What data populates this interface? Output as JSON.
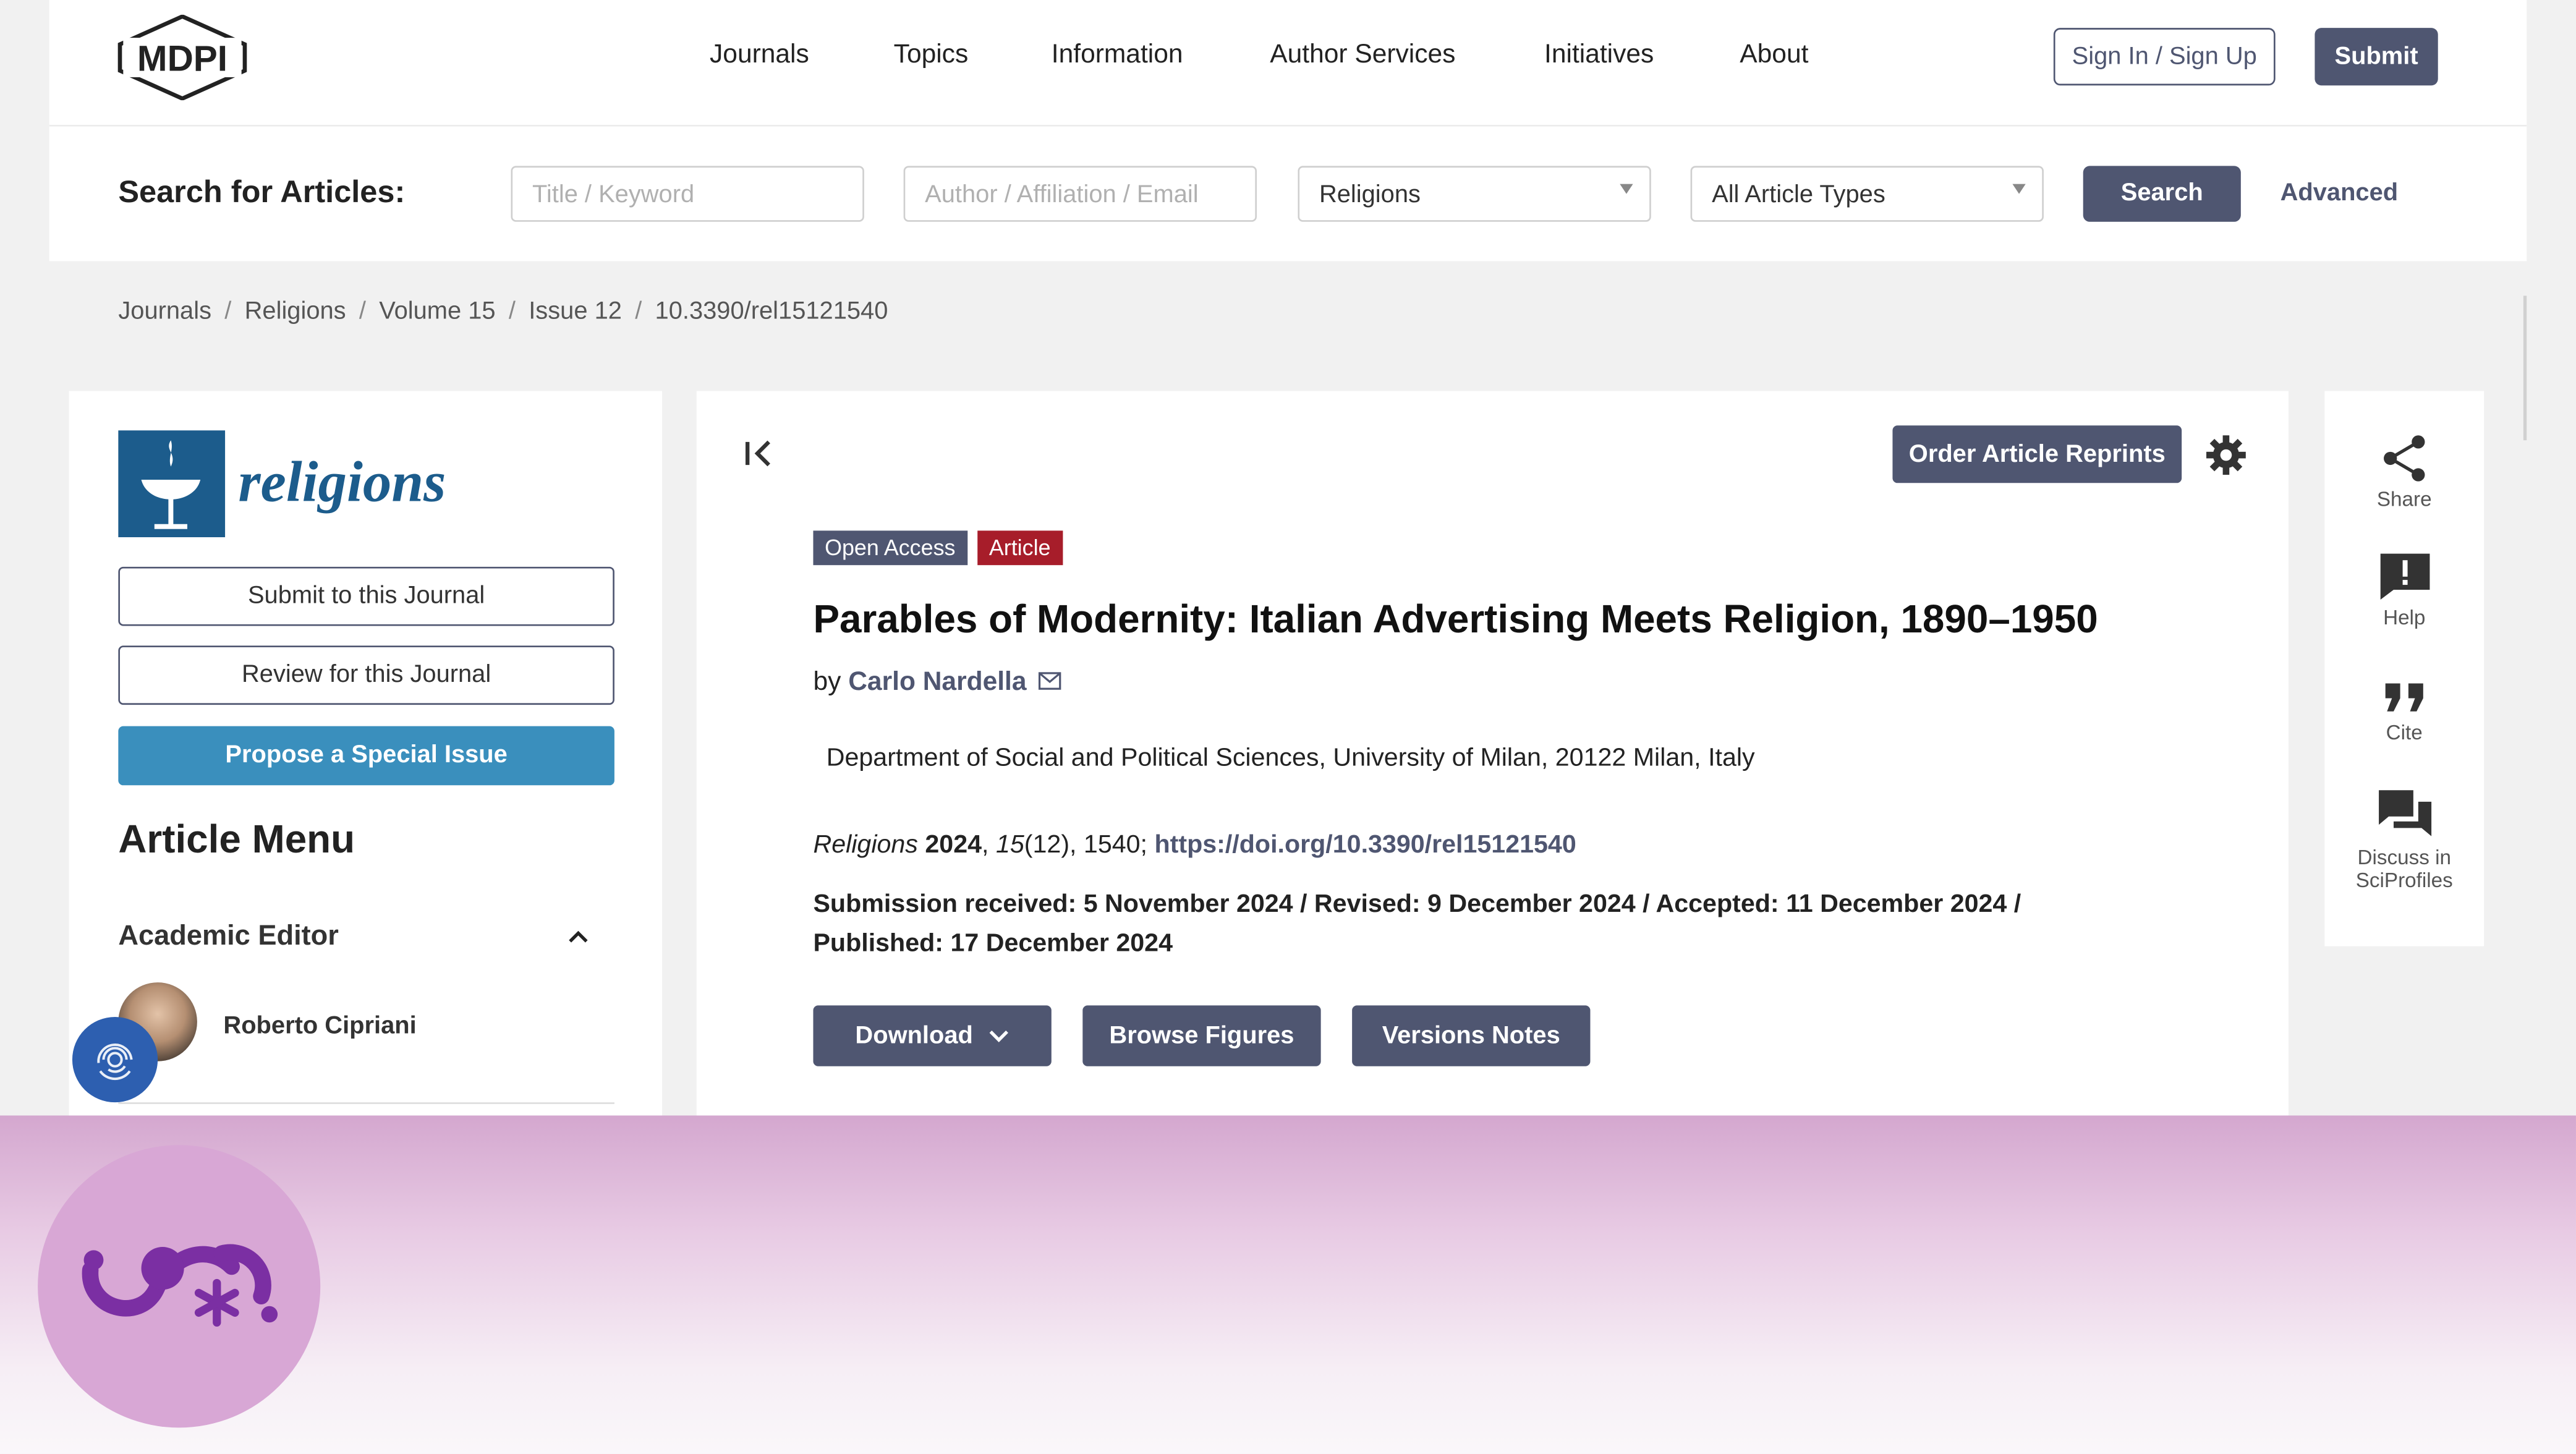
{
  "header": {
    "logo_text": "MDPI",
    "nav": [
      "Journals",
      "Topics",
      "Information",
      "Author Services",
      "Initiatives",
      "About"
    ],
    "sign_in": "Sign In / Sign Up",
    "submit": "Submit"
  },
  "search": {
    "label": "Search for Articles:",
    "keyword_placeholder": "Title / Keyword",
    "author_placeholder": "Author / Affiliation / Email",
    "journal_value": "Religions",
    "type_value": "All Article Types",
    "search_button": "Search",
    "advanced": "Advanced"
  },
  "breadcrumb": [
    "Journals",
    "Religions",
    "Volume 15",
    "Issue 12",
    "10.3390/rel15121540"
  ],
  "sidebar": {
    "journal_name": "religions",
    "submit": "Submit to this Journal",
    "review": "Review for this Journal",
    "propose": "Propose a Special Issue",
    "menu_title": "Article Menu",
    "editor_heading": "Academic Editor",
    "editor_name": "Roberto Cipriani"
  },
  "article": {
    "order_reprints": "Order Article Reprints",
    "badge_open": "Open Access",
    "badge_type": "Article",
    "title": "Parables of Modernity: Italian Advertising Meets Religion, 1890–1950",
    "by": "by",
    "author": "Carlo Nardella",
    "affiliation": "Department of Social and Political Sciences, University of Milan, 20122 Milan, Italy",
    "cite_journal": "Religions",
    "cite_year": "2024",
    "cite_volume": "15",
    "cite_rest": "(12), 1540;",
    "doi": "https://doi.org/10.3390/rel15121540",
    "dates_line1": "Submission received: 5 November 2024 / Revised: 9 December 2024 / Accepted: 11 December 2024 /",
    "dates_line2": "Published: 17 December 2024",
    "download": "Download",
    "browse": "Browse Figures",
    "versions": "Versions Notes"
  },
  "tools": {
    "share": "Share",
    "help": "Help",
    "cite": "Cite",
    "discuss": "Discuss in",
    "discuss2": "SciProfiles"
  },
  "colors": {
    "brand_dark": "#4f5671",
    "journal_blue": "#1c5c8c",
    "propose_blue": "#3a8fbd",
    "article_red": "#a71d2a"
  }
}
